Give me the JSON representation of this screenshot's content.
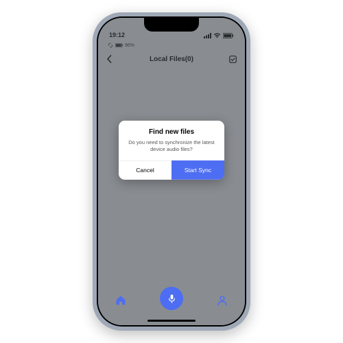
{
  "status": {
    "time": "19:12",
    "battery_secondary": "96%"
  },
  "header": {
    "title": "Local Files(0)"
  },
  "dialog": {
    "title": "Find new files",
    "message": "Do you need to synchronize the latest device audio files?",
    "cancel_label": "Cancel",
    "confirm_label": "Start Sync"
  },
  "colors": {
    "accent": "#4d6df2"
  }
}
